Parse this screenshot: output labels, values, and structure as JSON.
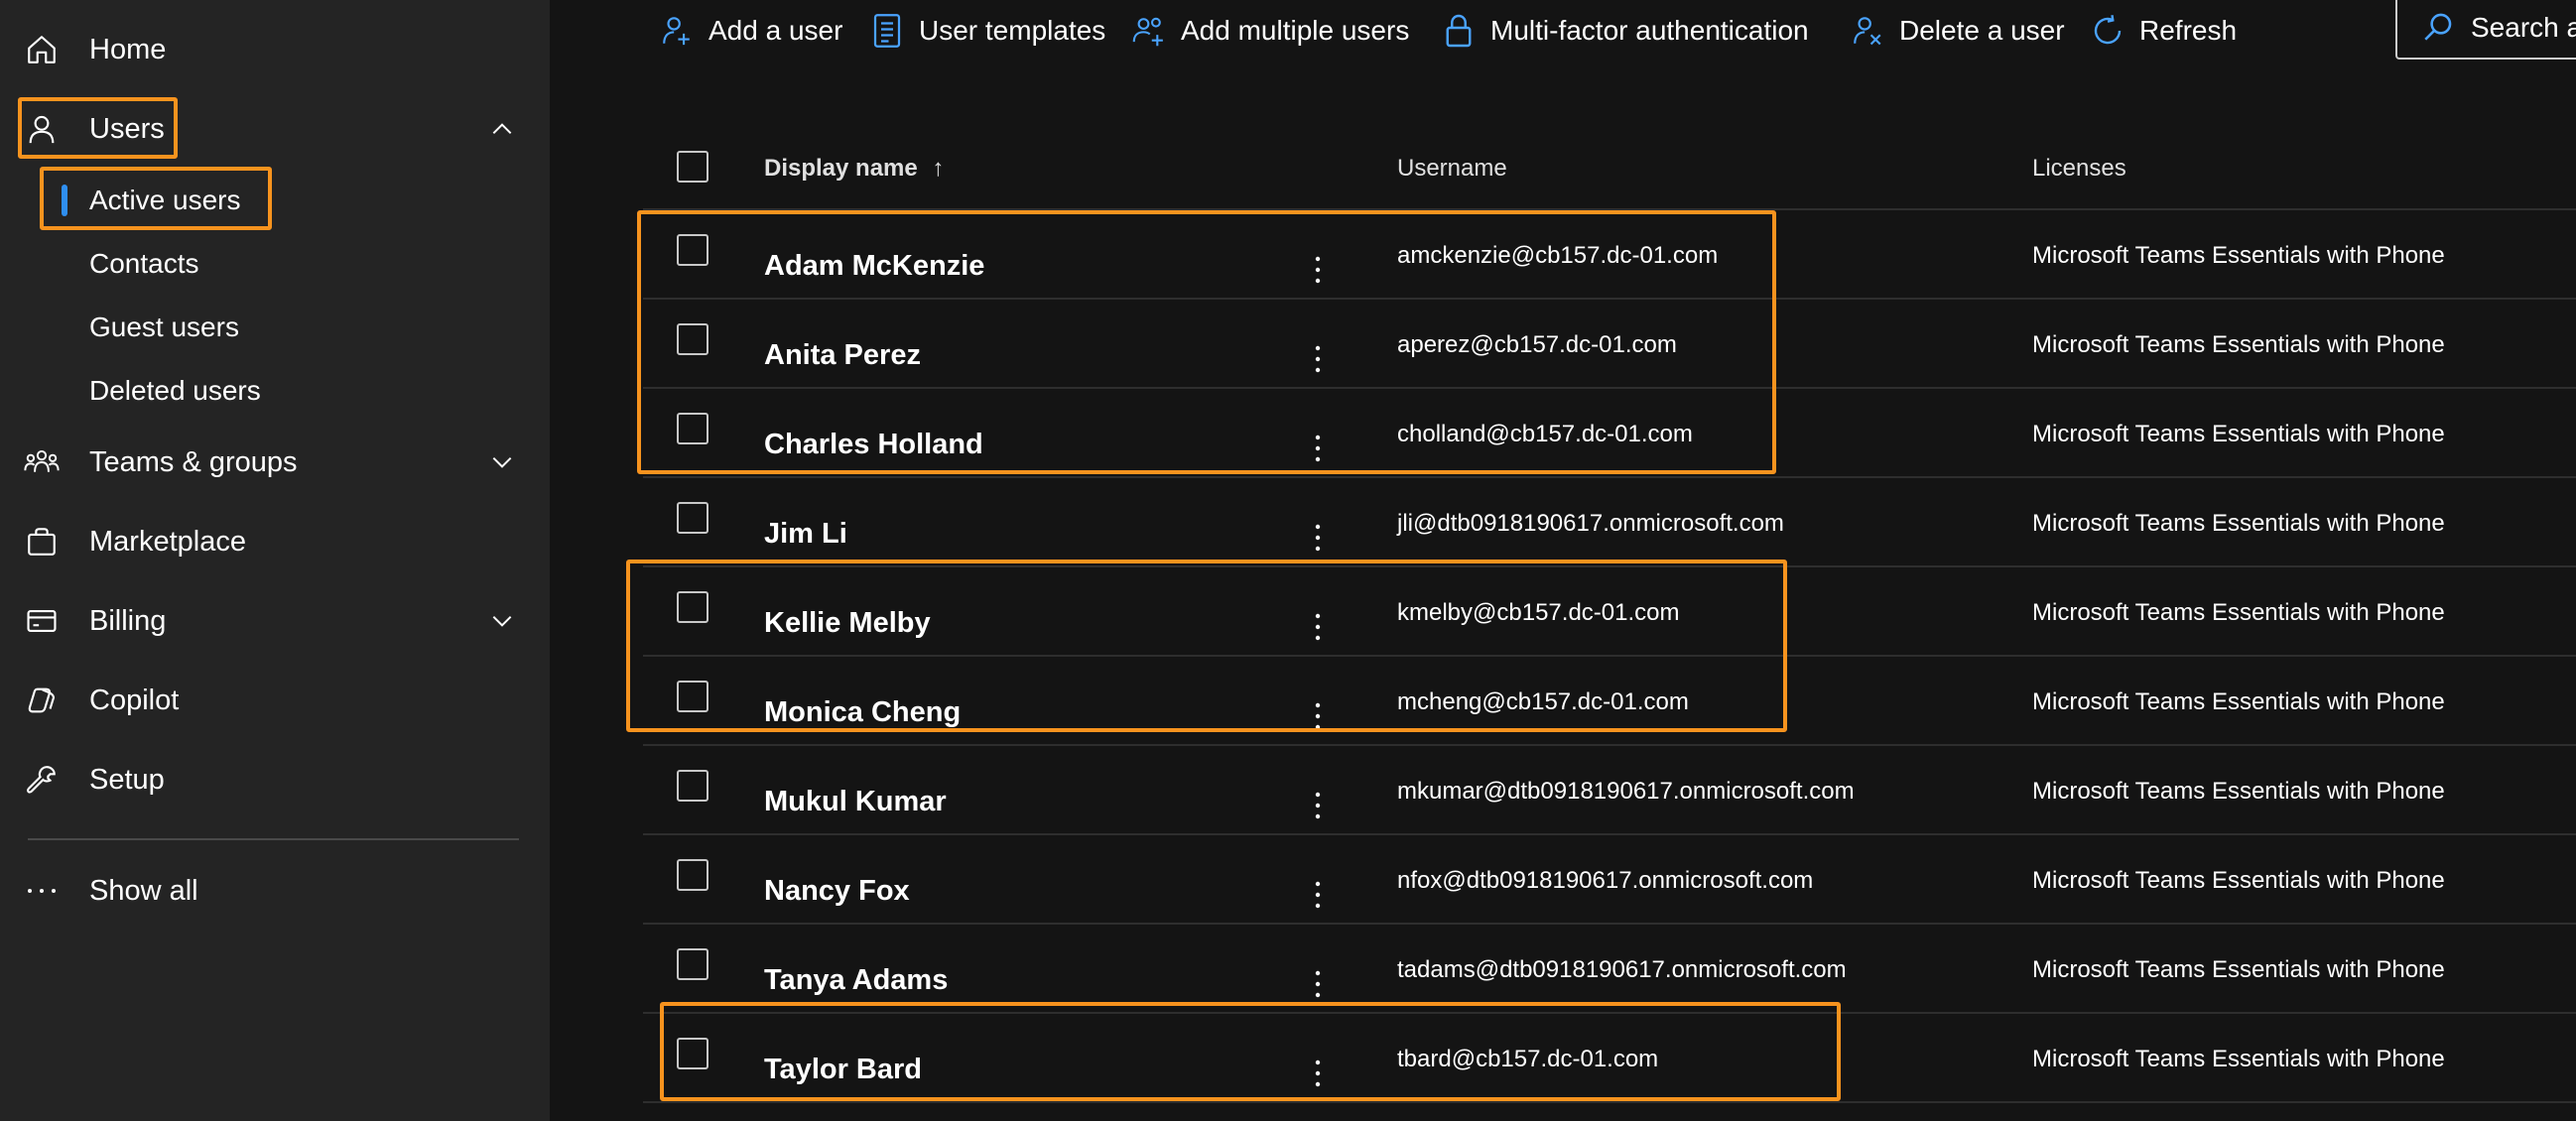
{
  "sidebar": {
    "items": [
      {
        "label": "Home",
        "icon": "home-icon"
      },
      {
        "label": "Users",
        "icon": "person-icon",
        "chevron": "chevron-up-icon"
      },
      {
        "label": "Teams & groups",
        "icon": "people-team-icon",
        "chevron": "chevron-down-icon"
      },
      {
        "label": "Marketplace",
        "icon": "shopping-bag-icon"
      },
      {
        "label": "Billing",
        "icon": "credit-card-icon",
        "chevron": "chevron-down-icon"
      },
      {
        "label": "Copilot",
        "icon": "copilot-icon"
      },
      {
        "label": "Setup",
        "icon": "wrench-icon"
      },
      {
        "label": "Show all",
        "icon": "more-horizontal-icon"
      }
    ],
    "users_subitems": [
      {
        "label": "Active users",
        "selected": true
      },
      {
        "label": "Contacts"
      },
      {
        "label": "Guest users"
      },
      {
        "label": "Deleted users"
      }
    ]
  },
  "toolbar": {
    "add_user": "Add a user",
    "user_templates": "User templates",
    "add_multiple_users": "Add multiple users",
    "mfa": "Multi-factor authentication",
    "delete_user": "Delete a user",
    "refresh": "Refresh",
    "search_placeholder": "Search a"
  },
  "table": {
    "columns": {
      "display_name": "Display name",
      "sort_indicator": "↑",
      "username": "Username",
      "licenses": "Licenses"
    },
    "rows": [
      {
        "name": "Adam McKenzie",
        "username": "amckenzie@cb157.dc-01.com",
        "license": "Microsoft Teams Essentials with Phone"
      },
      {
        "name": "Anita Perez",
        "username": "aperez@cb157.dc-01.com",
        "license": "Microsoft Teams Essentials with Phone"
      },
      {
        "name": "Charles Holland",
        "username": "cholland@cb157.dc-01.com",
        "license": "Microsoft Teams Essentials with Phone"
      },
      {
        "name": "Jim Li",
        "username": "jli@dtb0918190617.onmicrosoft.com",
        "license": "Microsoft Teams Essentials with Phone"
      },
      {
        "name": "Kellie Melby",
        "username": "kmelby@cb157.dc-01.com",
        "license": "Microsoft Teams Essentials with Phone"
      },
      {
        "name": "Monica Cheng",
        "username": "mcheng@cb157.dc-01.com",
        "license": "Microsoft Teams Essentials with Phone"
      },
      {
        "name": "Mukul Kumar",
        "username": "mkumar@dtb0918190617.onmicrosoft.com",
        "license": "Microsoft Teams Essentials with Phone"
      },
      {
        "name": "Nancy Fox",
        "username": "nfox@dtb0918190617.onmicrosoft.com",
        "license": "Microsoft Teams Essentials with Phone"
      },
      {
        "name": "Tanya Adams",
        "username": "tadams@dtb0918190617.onmicrosoft.com",
        "license": "Microsoft Teams Essentials with Phone"
      },
      {
        "name": "Taylor Bard",
        "username": "tbard@cb157.dc-01.com",
        "license": "Microsoft Teams Essentials with Phone"
      }
    ]
  },
  "colors": {
    "accent": "#2f8ff0",
    "highlight": "#f7931e",
    "sidebar_bg": "#242424",
    "main_bg": "#141414"
  }
}
